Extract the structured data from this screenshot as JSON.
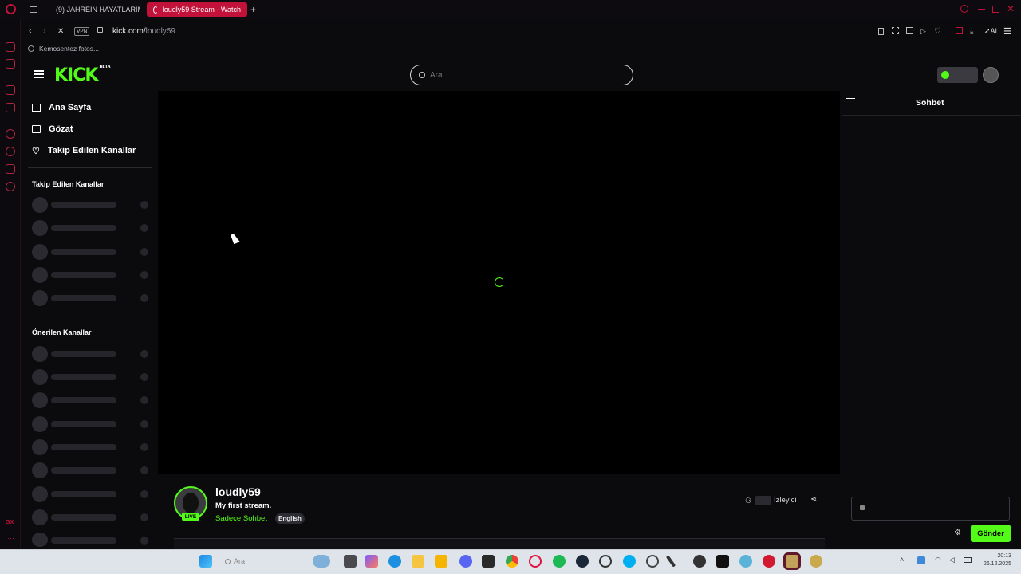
{
  "browser": {
    "tabs": [
      {
        "title": "(9) JAHREİN HAYATLARIM",
        "active": false
      },
      {
        "title": "loudly59 Stream - Watch",
        "active": true
      }
    ],
    "vpn_label": "VPN",
    "url_host": "kick.com/",
    "url_path": "loudly59",
    "bookmark_label": "Kemosentez fotos...",
    "ai_label": "AI"
  },
  "kick": {
    "logo_text": "KICK",
    "logo_badge": "BETA",
    "search_placeholder": "Ara",
    "nav": [
      {
        "label": "Ana Sayfa",
        "icon": "home-icon"
      },
      {
        "label": "Gözat",
        "icon": "browse-icon"
      },
      {
        "label": "Takip Edilen Kanallar",
        "icon": "heart-icon"
      }
    ],
    "followed_heading": "Takip Edilen Kanallar",
    "recommended_heading": "Önerilen Kanallar",
    "stream": {
      "channel": "loudly59",
      "title": "My first stream.",
      "category": "Sadece Sohbet",
      "language": "English",
      "live_badge": "LIVE",
      "viewers_label": "İzleyici"
    },
    "chat": {
      "title": "Sohbet",
      "send_label": "Gönder"
    }
  },
  "taskbar": {
    "search_label": "Ara",
    "time": "20:13",
    "date": "26.12.2025"
  },
  "colors": {
    "accent": "#53fc18",
    "opera_red": "#c2123a",
    "background": "#0b0b0e"
  }
}
